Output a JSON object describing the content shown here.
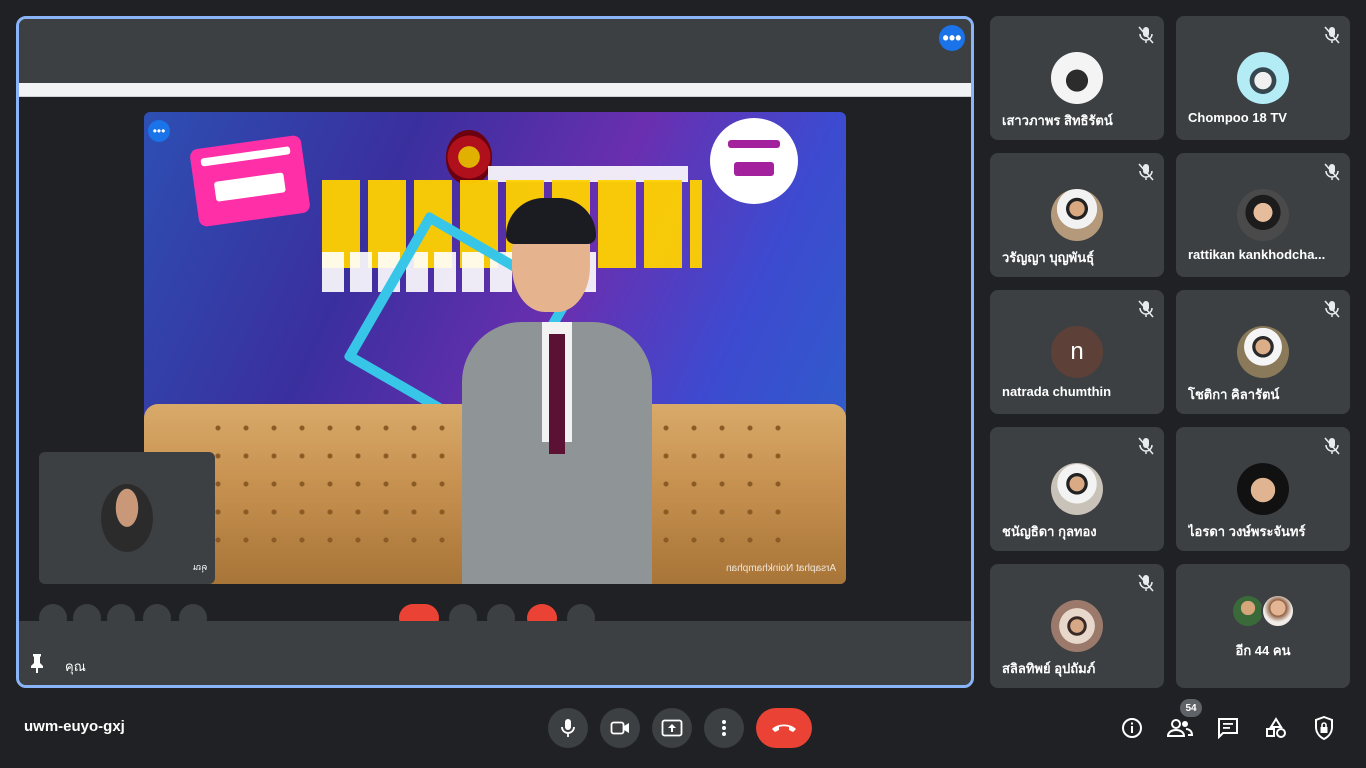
{
  "meeting": {
    "code": "uwm-euyo-gxj"
  },
  "stage": {
    "presenter_label": "คุณ",
    "self_preview_label": "คุณ",
    "caption": "Arsaphat Noinkhamphan"
  },
  "participants": [
    {
      "name": "เสาวภาพร สิทธิรัตน์",
      "avatar": "cartoon-avatar",
      "muted": true
    },
    {
      "name": "Chompoo 18 TV",
      "avatar": "cartoon-avatar",
      "muted": true
    },
    {
      "name": "วรัญญา บุญพันธุ์",
      "avatar": "photo-avatar",
      "muted": true
    },
    {
      "name": "rattikan kankhodcha...",
      "avatar": "photo-avatar",
      "muted": true
    },
    {
      "name": "natrada chumthin",
      "avatar_letter": "n",
      "muted": true
    },
    {
      "name": "โชติกา คิลารัตน์",
      "avatar": "photo-avatar",
      "muted": true
    },
    {
      "name": "ชนัญธิดา กุลทอง",
      "avatar": "photo-avatar",
      "muted": true
    },
    {
      "name": "ไอรดา วงษ์พระจันทร์",
      "avatar": "photo-avatar",
      "muted": true
    },
    {
      "name": "สลิลทิพย์ อุปถัมภ์",
      "avatar": "photo-avatar",
      "muted": true
    }
  ],
  "others": {
    "label": "อีก 44 คน"
  },
  "toolbar": {
    "people_count": "54",
    "controls": [
      "mic-icon",
      "camera-icon",
      "present-icon",
      "more-vert-icon",
      "end-call-icon"
    ],
    "right_controls": [
      "info-icon",
      "people-icon",
      "chat-icon",
      "activities-icon",
      "host-controls-icon"
    ]
  },
  "colors": {
    "background": "#202124",
    "tile": "#3c4043",
    "accent": "#8ab4f8",
    "end_call": "#ea4335"
  }
}
